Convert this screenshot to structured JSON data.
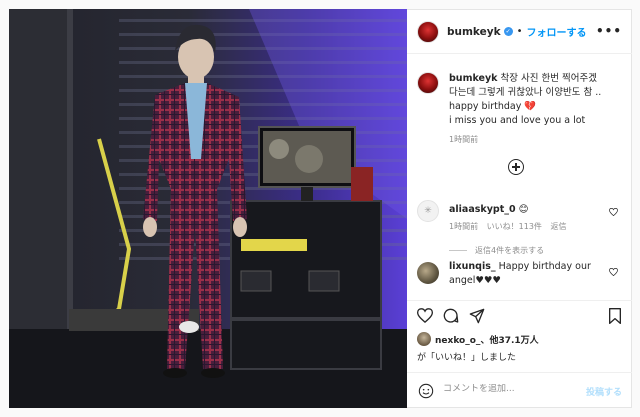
{
  "post": {
    "username": "bumkeyk",
    "verified_glyph": "✓",
    "separator": "•",
    "follow_label": "フォローする",
    "more_label": "•••"
  },
  "caption": {
    "username": "bumkeyk",
    "text_line1": " 착장 사진 한번 찍어주겠",
    "text_line2": "다는데 그렇게 귀찮았나 이양반도 참 ..",
    "text_line3": "happy birthday 💔",
    "text_line4": "i miss you and love you a lot",
    "time": "1時間前"
  },
  "comments": [
    {
      "username": "aliaaskypt_0",
      "text": "😊",
      "time": "1時間前",
      "likes": "いいね！113件",
      "reply": "返信",
      "view_replies": "返信4件を表示する"
    },
    {
      "username": "lixunqis_",
      "text": " Happy birthday our angel♥♥♥"
    }
  ],
  "likes": {
    "line1_user": "nexko_o_",
    "line1_rest": "、他37.1万人",
    "line2": "が「いいね！」しました"
  },
  "add_comment": {
    "placeholder": "コメントを追加...",
    "post_label": "投稿する"
  },
  "icons": [
    "heart-icon",
    "comment-icon",
    "share-icon",
    "bookmark-icon",
    "smile-icon",
    "add-icon",
    "verified-icon"
  ],
  "colors": {
    "follow": "#0095f6",
    "muted": "#8e8e8e",
    "post_disabled": "#b2dffc",
    "stage_light": "#5a3fd6"
  }
}
